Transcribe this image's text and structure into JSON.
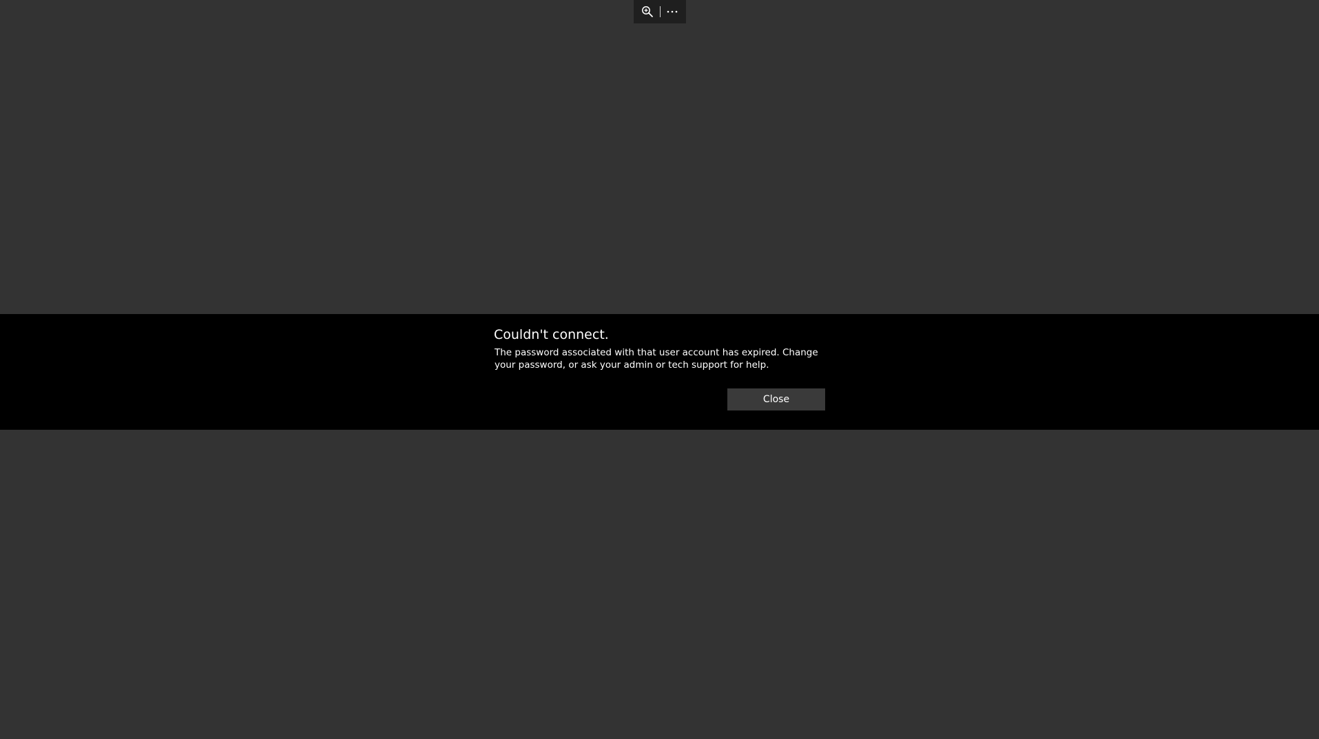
{
  "toolbar": {
    "zoom_icon": "zoom-in-icon",
    "more_icon": "more-options-icon"
  },
  "dialog": {
    "title": "Couldn't connect.",
    "message": "The password associated with that user account has expired. Change your password, or ask your admin or tech support for help.",
    "close_label": "Close"
  },
  "colors": {
    "background": "#333333",
    "band": "#000000",
    "toolbar": "#1f1f1f",
    "button": "#3a3a3a",
    "text": "#ffffff"
  }
}
